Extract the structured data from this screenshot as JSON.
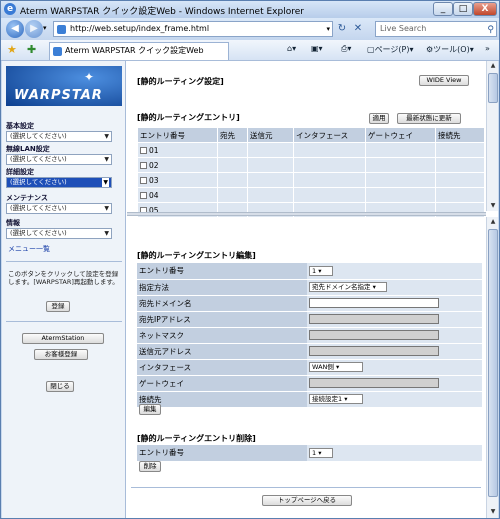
{
  "window": {
    "title": "Aterm WARPSTAR クイック設定Web - Windows Internet Explorer",
    "min": "_",
    "max": "□",
    "close": "X"
  },
  "address": {
    "url": "http://web.setup/index_frame.html",
    "search_placeholder": "Live Search"
  },
  "tab": {
    "label": "Aterm WARPSTAR クイック設定Web"
  },
  "commands": {
    "page": "ページ(P)",
    "tools": "ツール(O)"
  },
  "sidebar": {
    "logo": "WARPSTAR",
    "menus": [
      {
        "label": "基本設定",
        "value": "(選択してください)"
      },
      {
        "label": "無線LAN設定",
        "value": "(選択してください)"
      },
      {
        "label": "詳細設定",
        "value": "(選択してください)"
      },
      {
        "label": "メンテナンス",
        "value": "(選択してください)"
      },
      {
        "label": "情報",
        "value": "(選択してください)"
      }
    ],
    "menu_list": "メニュー一覧",
    "note": "このボタンをクリックして設定を登録します。[WARPSTAR]再起動します。",
    "register": "登録",
    "atermstation": "AtermStation",
    "customer": "お客様登録",
    "close": "閉じる"
  },
  "top": {
    "title": "[静的ルーティング設定]",
    "wide_view": "WIDE View",
    "entry_title": "[静的ルーティングエントリ]",
    "apply": "適用",
    "refresh": "最新状態に更新",
    "columns": [
      "エントリ番号",
      "宛先",
      "送信元",
      "インタフェース",
      "ゲートウェイ",
      "接続先"
    ],
    "rows": [
      "01",
      "02",
      "03",
      "04",
      "05"
    ]
  },
  "edit": {
    "title": "[静的ルーティングエントリ編集]",
    "fields": [
      {
        "label": "エントリ番号",
        "value": "1"
      },
      {
        "label": "指定方法",
        "value": "宛先ドメイン名指定"
      },
      {
        "label": "宛先ドメイン名",
        "value": ""
      },
      {
        "label": "宛先IPアドレス",
        "value": ""
      },
      {
        "label": "ネットマスク",
        "value": ""
      },
      {
        "label": "送信元アドレス",
        "value": ""
      },
      {
        "label": "インタフェース",
        "value": "WAN側"
      },
      {
        "label": "ゲートウェイ",
        "value": ""
      },
      {
        "label": "接続先",
        "value": "接続設定1"
      }
    ],
    "edit_button": "編集"
  },
  "delete": {
    "title": "[静的ルーティングエントリ削除]",
    "field_label": "エントリ番号",
    "field_value": "1",
    "delete_button": "削除"
  },
  "footer": {
    "top_button": "トップページへ戻る"
  }
}
